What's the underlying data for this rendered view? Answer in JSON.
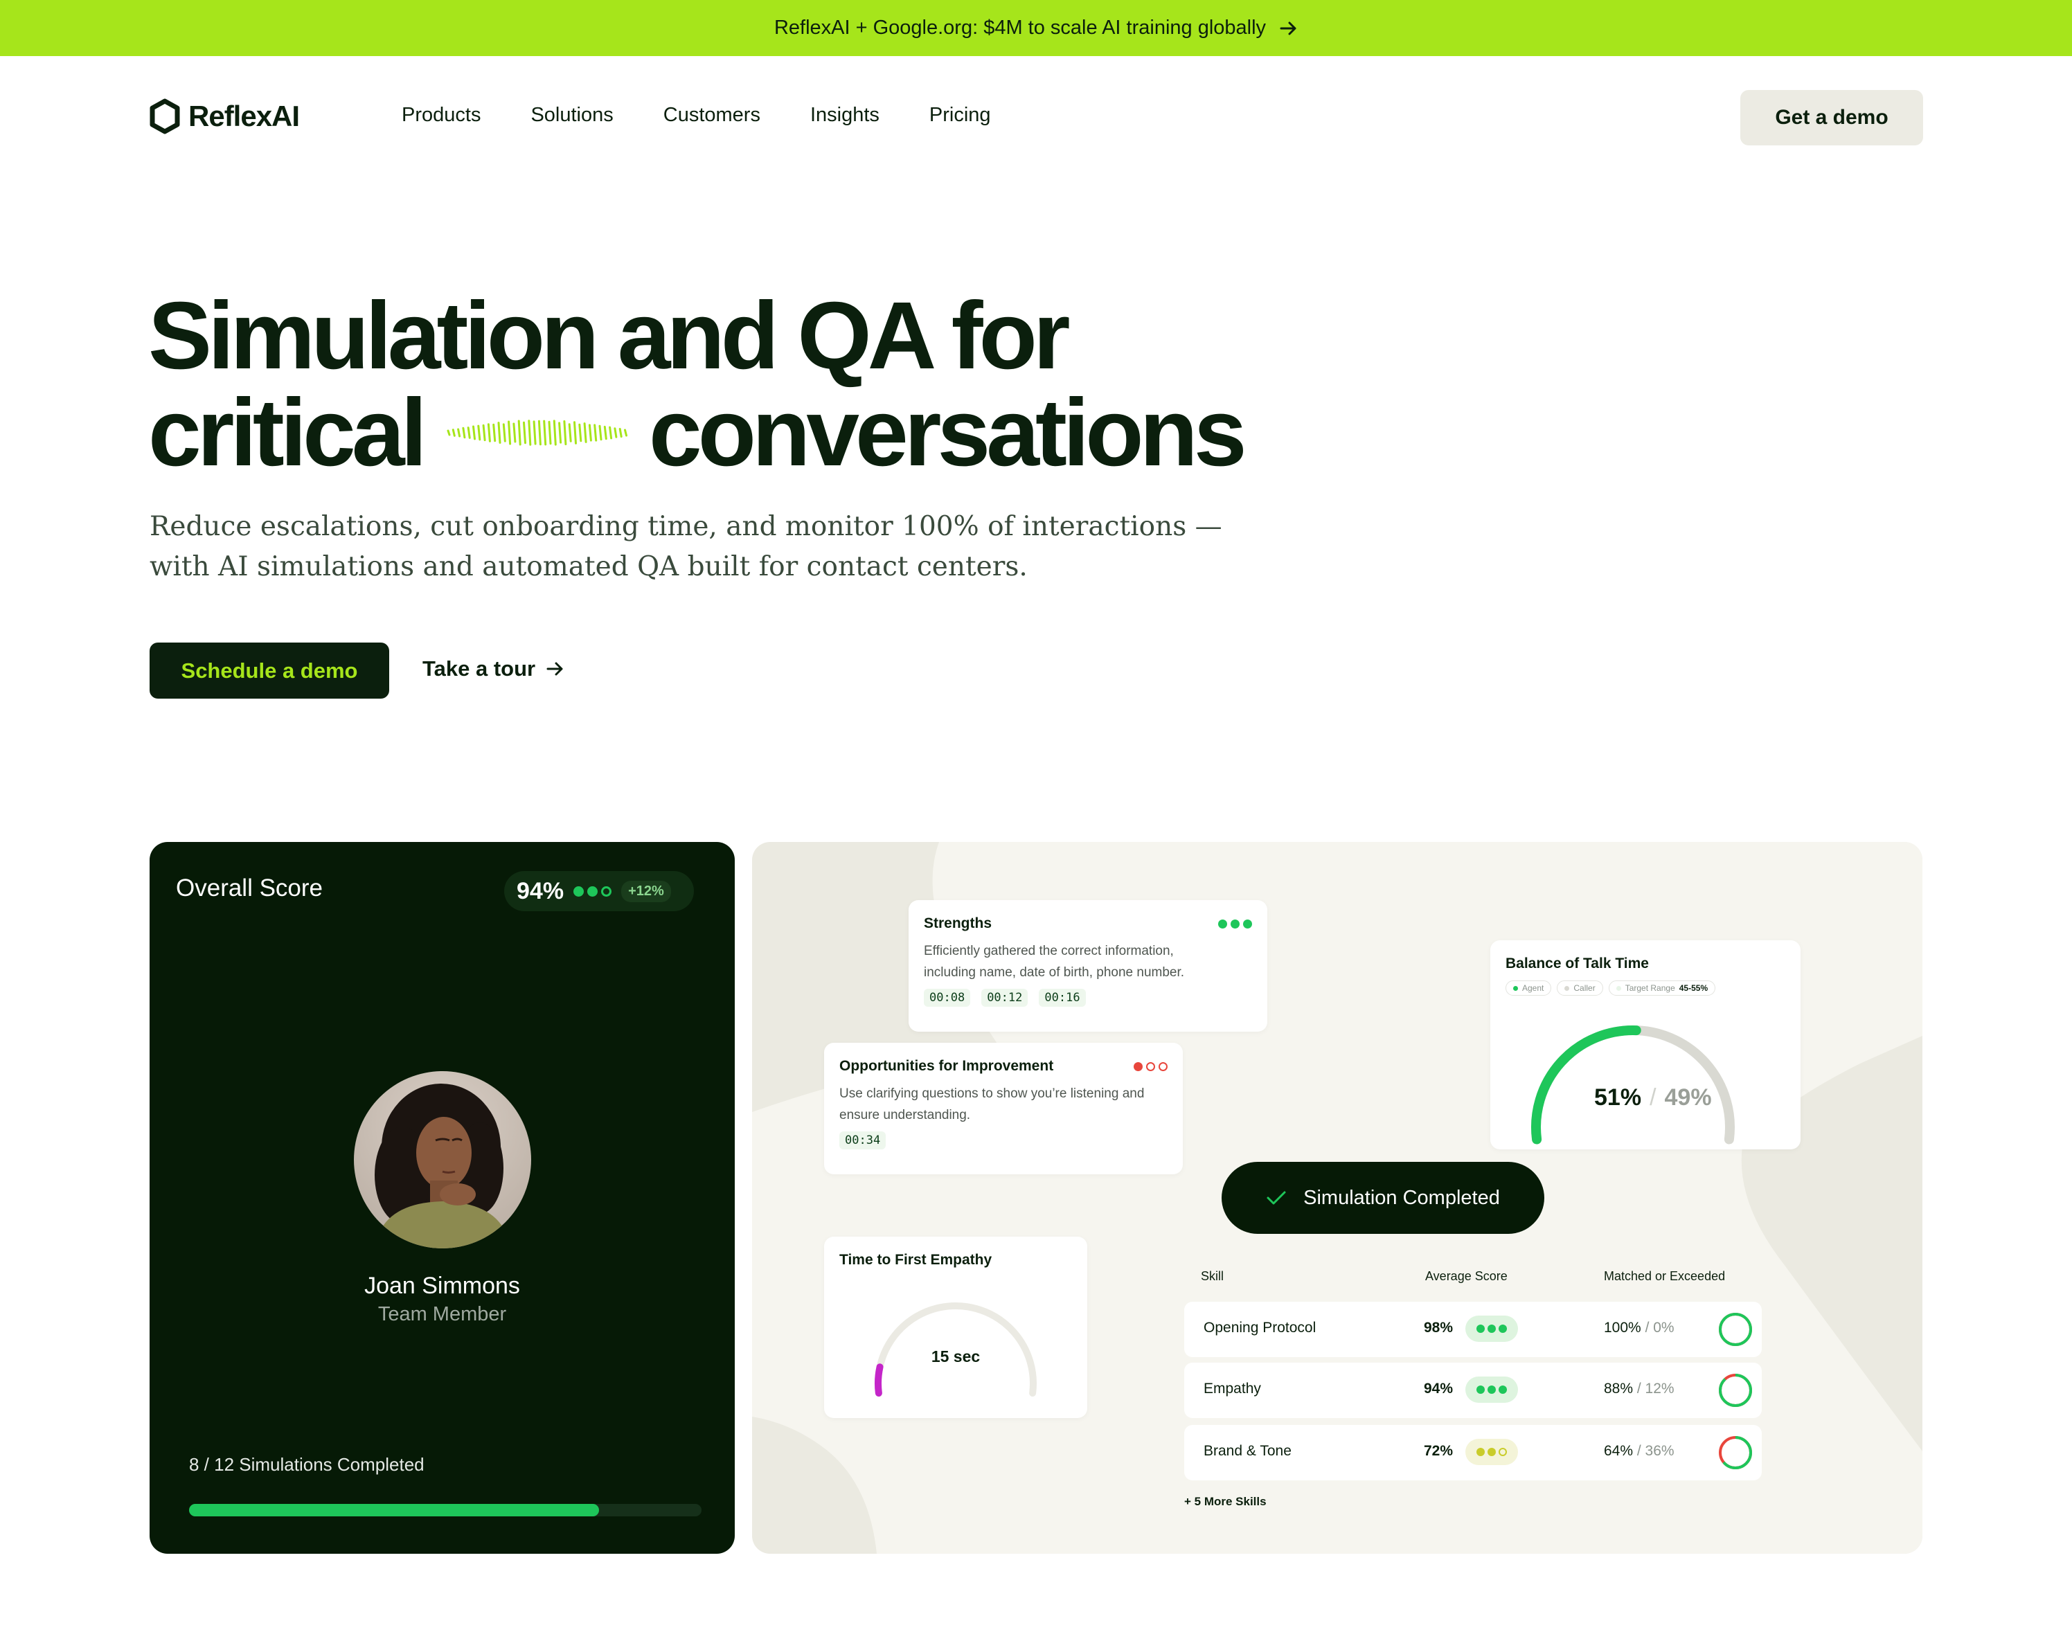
{
  "announcement": {
    "text": "ReflexAI + Google.org: $4M to scale AI training globally"
  },
  "brand": {
    "name": "ReflexAI",
    "accent": "#a6e51b",
    "dark": "#0b1f0d",
    "green": "#1ec65a"
  },
  "nav": {
    "items": [
      {
        "label": "Products"
      },
      {
        "label": "Solutions"
      },
      {
        "label": "Customers"
      },
      {
        "label": "Insights"
      },
      {
        "label": "Pricing"
      }
    ],
    "cta_label": "Get a demo"
  },
  "hero": {
    "title_line1": "Simulation and QA for",
    "title_line2a": "critical",
    "title_line2b": "conversations",
    "subtitle": "Reduce escalations, cut onboarding time, and monitor 100% of interactions — with AI simulations and automated QA built for contact centers.",
    "primary_cta": "Schedule a demo",
    "secondary_cta": "Take a tour"
  },
  "score_card": {
    "label": "Overall Score",
    "score": "94%",
    "delta": "+12%",
    "person_name": "Joan Simmons",
    "person_role": "Team Member",
    "simulations_text": "8 / 12 Simulations Completed",
    "progress": 0.8
  },
  "strengths": {
    "title": "Strengths",
    "body": "Efficiently gathered the correct information, including name, date of birth, phone number.",
    "timestamps": [
      "00:08",
      "00:12",
      "00:16"
    ]
  },
  "opportunities": {
    "title": "Opportunities for Improvement",
    "body": "Use clarifying questions to show you’re listening and ensure understanding.",
    "timestamps": [
      "00:34"
    ]
  },
  "talk_time": {
    "title": "Balance of Talk Time",
    "legend": {
      "agent": "Agent",
      "caller": "Caller",
      "target_label": "Target Range",
      "target_value": "45-55%"
    },
    "agent_pct": "51%",
    "caller_pct": "49%",
    "agent_value": 51
  },
  "empathy": {
    "title": "Time to First Empathy",
    "value_text": "15 sec",
    "fraction": 0.1
  },
  "simulation_status": "Simulation Completed",
  "skills_table": {
    "headers": {
      "skill": "Skill",
      "average": "Average Score",
      "matched": "Matched or Exceeded"
    },
    "rows": [
      {
        "skill": "Opening Protocol",
        "score": "98%",
        "dots": 3,
        "matched": "100%",
        "missed": "/ 0%",
        "matched_value": 100
      },
      {
        "skill": "Empathy",
        "score": "94%",
        "dots": 3,
        "matched": "88%",
        "missed": "/ 12%",
        "matched_value": 88
      },
      {
        "skill": "Brand & Tone",
        "score": "72%",
        "dots": 2,
        "matched": "64%",
        "missed": "/ 36%",
        "matched_value": 64
      }
    ],
    "more": "+ 5 More Skills"
  },
  "icons": [
    "arrow-right-icon",
    "reflexai-logo-icon",
    "check-icon",
    "waveform-icon"
  ]
}
